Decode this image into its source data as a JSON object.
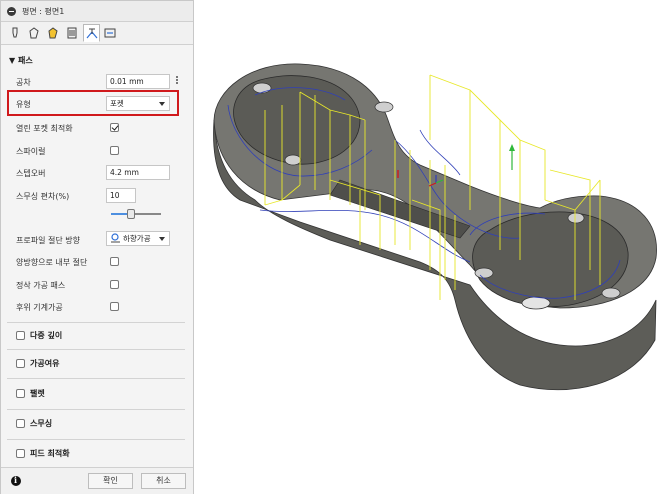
{
  "dialog": {
    "title": "평면 : 평면1",
    "tabs": [
      "tool-icon",
      "shape-icon",
      "geometry-icon",
      "heights-icon",
      "passes-icon",
      "linking-icon"
    ],
    "active_tab_index": 3
  },
  "passes": {
    "header": "패스",
    "tolerance_label": "공차",
    "tolerance_value": "0.01 mm",
    "type_label": "유형",
    "type_value": "포켓",
    "open_pocket_label": "열린 포켓 최적화",
    "open_pocket_checked": true,
    "spiral_label": "스파이럴",
    "spiral_checked": false,
    "stepover_label": "스텝오버",
    "stepover_value": "4.2 mm",
    "smoothing_label": "스무싱 편차(%)",
    "smoothing_value": "10",
    "smoothing_slider": 0.4,
    "profile_cut_label": "프로파일 절단 방향",
    "profile_cut_value": "하향가공",
    "both_ways_label": "양방향으로 내부 절단",
    "both_ways_checked": false,
    "finish_pass_label": "정삭 가공 패스",
    "finish_pass_checked": false,
    "rest_machining_label": "후위 기계가공",
    "rest_machining_checked": false
  },
  "groups": [
    {
      "label": "다중 깊이",
      "checked": false
    },
    {
      "label": "가공여유",
      "checked": false
    },
    {
      "label": "팰렛",
      "checked": false
    },
    {
      "label": "스무싱",
      "checked": false
    },
    {
      "label": "피드 최적화",
      "checked": false
    }
  ],
  "footer": {
    "ok_label": "확인",
    "cancel_label": "취소"
  },
  "colors": {
    "highlight": "#d0191c",
    "toolpath_yellow": "#e8e82a",
    "toolpath_blue": "#2f3fb8",
    "part_gray": "#6b6b66"
  }
}
